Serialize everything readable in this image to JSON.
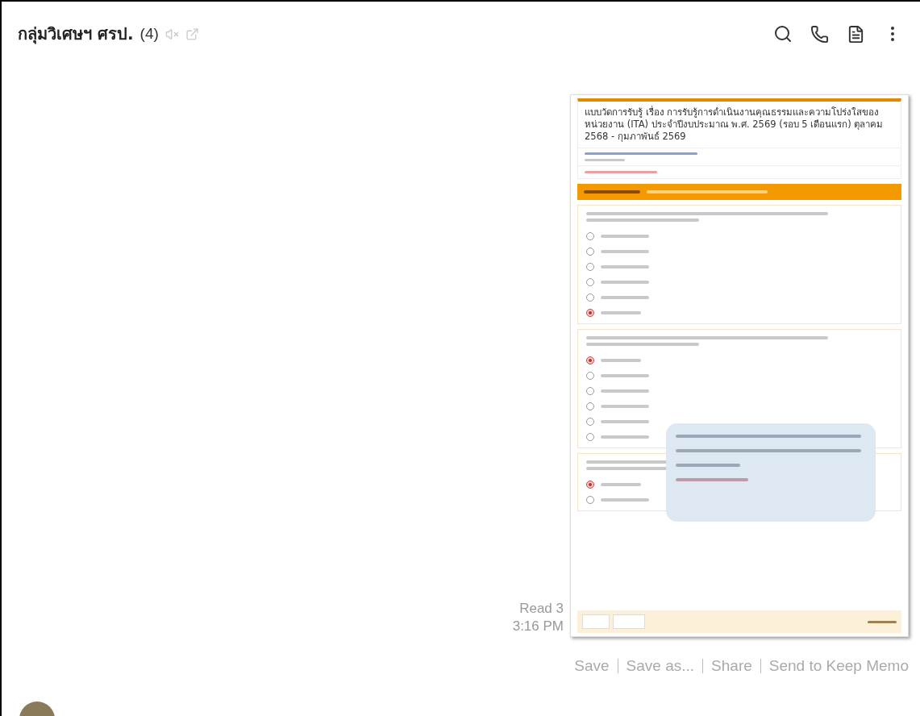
{
  "header": {
    "title": "กลุ่มวิเศษฯ ศรป.",
    "member_count": "(4)"
  },
  "message": {
    "read_status": "Read 3",
    "time": "3:16 PM",
    "form": {
      "title": "แบบวัดการรับรู้ เรื่อง การรับรู้การดำเนินงานคุณธรรมและความโปร่งใสของหน่วยงาน (ITA) ประจำปีงบประมาณ พ.ศ. 2569 (รอบ 5 เดือนแรก) ตุลาคม 2568 - กุมภาพันธ์ 2569",
      "questions": [
        {
          "options": [
            {
              "selected": false
            },
            {
              "selected": false
            },
            {
              "selected": false
            },
            {
              "selected": false
            },
            {
              "selected": false
            },
            {
              "selected": true
            }
          ]
        },
        {
          "options": [
            {
              "selected": true
            },
            {
              "selected": false
            },
            {
              "selected": false
            },
            {
              "selected": false
            },
            {
              "selected": false
            },
            {
              "selected": false
            }
          ]
        },
        {
          "options": [
            {
              "selected": true
            },
            {
              "selected": false
            }
          ]
        }
      ]
    }
  },
  "actions": [
    "Save",
    "Save as...",
    "Share",
    "Send to Keep Memo"
  ]
}
